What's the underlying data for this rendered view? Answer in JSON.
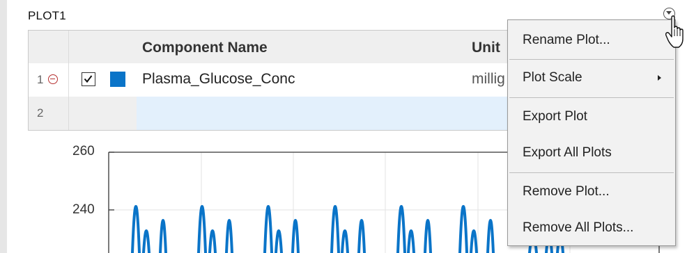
{
  "plot": {
    "title": "PLOT1",
    "colors": {
      "series": "#0a74c8",
      "remove_icon": "#b52f2f"
    }
  },
  "table": {
    "headers": {
      "name": "Component Name",
      "unit": "Unit"
    },
    "rows": [
      {
        "index": "1",
        "checked": true,
        "name": "Plasma_Glucose_Conc",
        "unit": "milligram/deciliter"
      },
      {
        "index": "2",
        "name": "",
        "unit": ""
      }
    ]
  },
  "axis": {
    "yticks": [
      "260",
      "240"
    ]
  },
  "menu": {
    "items": [
      {
        "label": "Rename Plot..."
      },
      {
        "label": "Plot Scale",
        "has_submenu": true
      },
      {
        "label": "Export Plot"
      },
      {
        "label": "Export All Plots"
      },
      {
        "label": "Remove Plot..."
      },
      {
        "label": "Remove All Plots..."
      }
    ]
  }
}
